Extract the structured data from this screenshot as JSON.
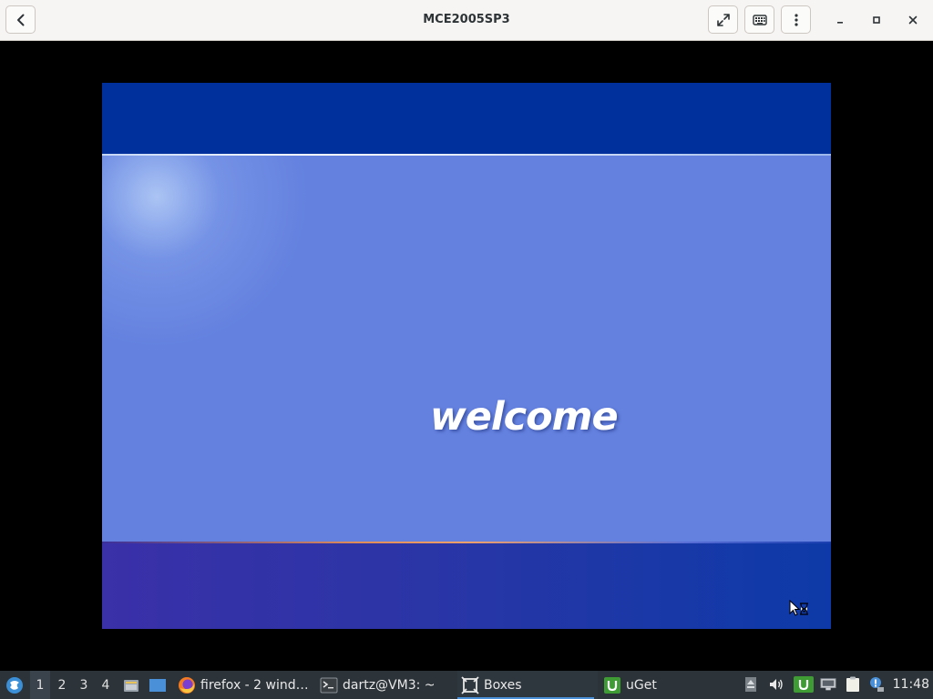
{
  "window": {
    "title": "MCE2005SP3"
  },
  "guest": {
    "welcome_text": "welcome"
  },
  "taskbar": {
    "workspaces": [
      "1",
      "2",
      "3",
      "4"
    ],
    "active_workspace": "1",
    "tasks": [
      {
        "label": "firefox - 2 wind…",
        "icon": "firefox-icon"
      },
      {
        "label": "dartz@VM3: ~",
        "icon": "terminal-icon"
      },
      {
        "label": "Boxes",
        "icon": "boxes-icon",
        "active": true
      },
      {
        "label": "uGet",
        "icon": "uget-icon"
      }
    ],
    "clock": "11:48"
  },
  "colors": {
    "guest_top": "#00309c",
    "guest_middle": "#6481df",
    "guest_bottom": "#2a35a6",
    "taskbar": "#2c3339",
    "headerbar": "#f6f5f4"
  }
}
